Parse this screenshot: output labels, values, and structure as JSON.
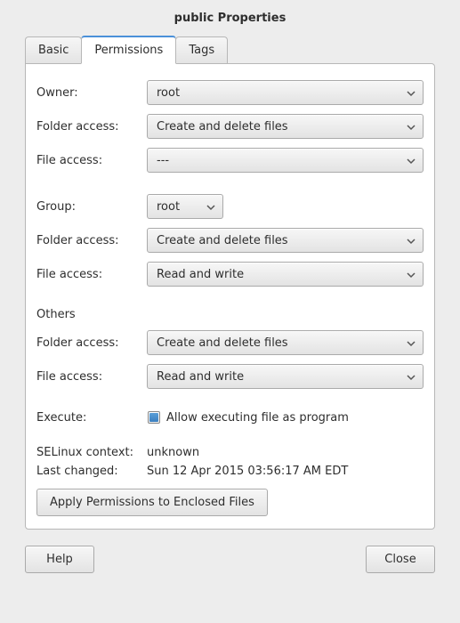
{
  "window": {
    "title": "public Properties"
  },
  "tabs": {
    "basic": "Basic",
    "permissions": "Permissions",
    "tags": "Tags"
  },
  "perm": {
    "owner_label": "Owner:",
    "owner_value": "root",
    "folder_access_label": "Folder access:",
    "file_access_label": "File access:",
    "owner_folder_access": "Create and delete files",
    "owner_file_access": "---",
    "group_label": "Group:",
    "group_value": "root",
    "group_folder_access": "Create and delete files",
    "group_file_access": "Read and write",
    "others_label": "Others",
    "others_folder_access": "Create and delete files",
    "others_file_access": "Read and write",
    "execute_label": "Execute:",
    "execute_check_label": "Allow executing file as program",
    "selinux_label": "SELinux context:",
    "selinux_value": "unknown",
    "lastchanged_label": "Last changed:",
    "lastchanged_value": "Sun 12 Apr 2015 03:56:17 AM EDT",
    "apply_button": "Apply Permissions to Enclosed Files"
  },
  "footer": {
    "help": "Help",
    "close": "Close"
  }
}
